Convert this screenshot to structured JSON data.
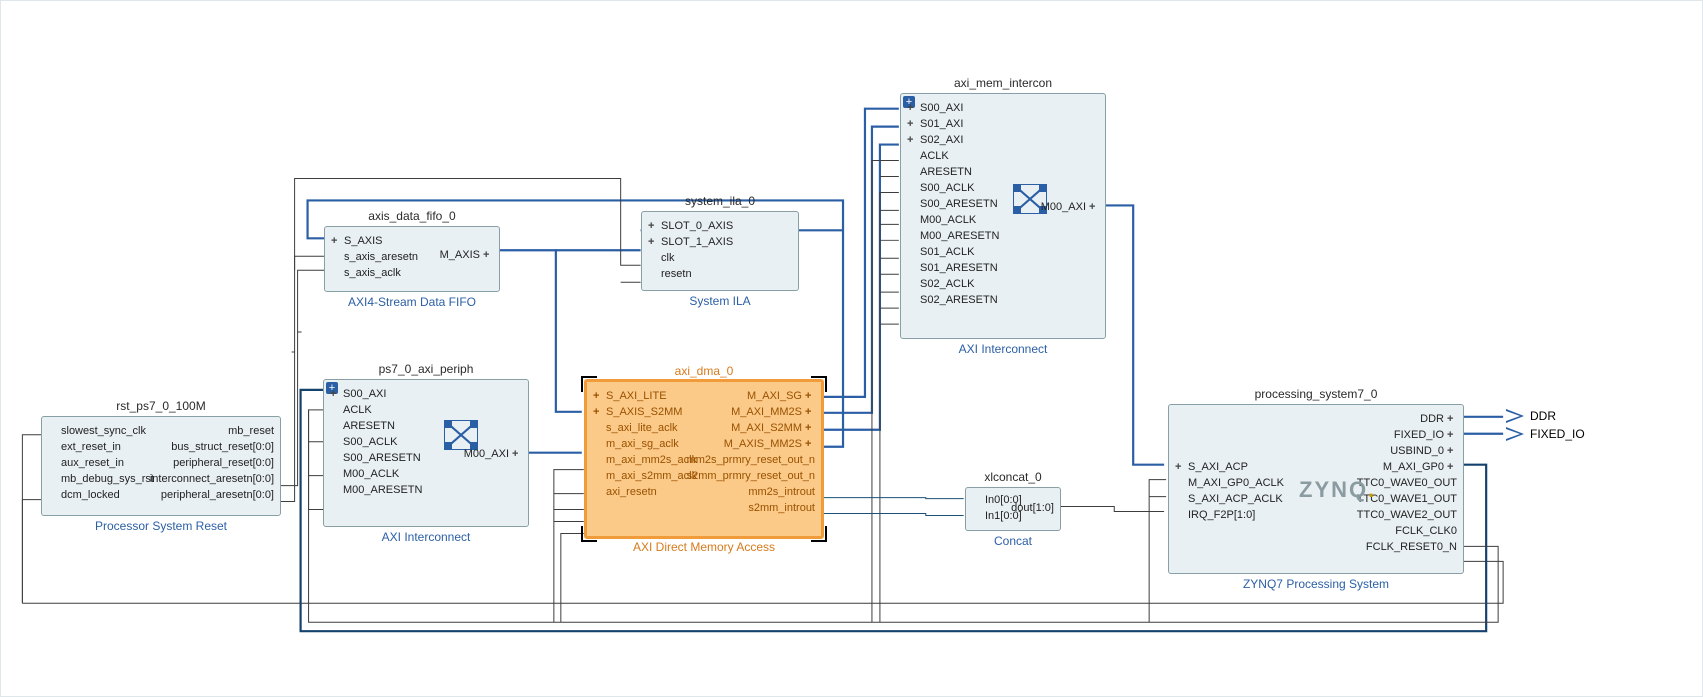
{
  "blocks": {
    "rst": {
      "title": "rst_ps7_0_100M",
      "subtitle": "Processor System Reset",
      "left": [
        "slowest_sync_clk",
        "ext_reset_in",
        "aux_reset_in",
        "mb_debug_sys_rst",
        "dcm_locked"
      ],
      "right": [
        "mb_reset",
        "bus_struct_reset[0:0]",
        "peripheral_reset[0:0]",
        "interconnect_aresetn[0:0]",
        "peripheral_aresetn[0:0]"
      ]
    },
    "fifo": {
      "title": "axis_data_fifo_0",
      "subtitle": "AXI4-Stream Data FIFO",
      "left_bus": [
        "S_AXIS"
      ],
      "left": [
        "s_axis_aresetn",
        "s_axis_aclk"
      ],
      "right_bus": [
        "M_AXIS"
      ]
    },
    "ila": {
      "title": "system_ila_0",
      "subtitle": "System ILA",
      "left_bus": [
        "SLOT_0_AXIS",
        "SLOT_1_AXIS"
      ],
      "left": [
        "clk",
        "resetn"
      ]
    },
    "periph": {
      "title": "ps7_0_axi_periph",
      "subtitle": "AXI Interconnect",
      "left_bus": [
        "S00_AXI"
      ],
      "left": [
        "ACLK",
        "ARESETN",
        "S00_ACLK",
        "S00_ARESETN",
        "M00_ACLK",
        "M00_ARESETN"
      ],
      "right_bus": [
        "M00_AXI"
      ]
    },
    "dma": {
      "title": "axi_dma_0",
      "subtitle": "AXI Direct Memory Access",
      "left_bus": [
        "S_AXI_LITE",
        "S_AXIS_S2MM"
      ],
      "left": [
        "s_axi_lite_aclk",
        "m_axi_sg_aclk",
        "m_axi_mm2s_aclk",
        "m_axi_s2mm_aclk",
        "axi_resetn"
      ],
      "right_bus": [
        "M_AXI_SG",
        "M_AXI_MM2S",
        "M_AXI_S2MM",
        "M_AXIS_MM2S"
      ],
      "right": [
        "mm2s_prmry_reset_out_n",
        "s2mm_prmry_reset_out_n",
        "mm2s_introut",
        "s2mm_introut"
      ]
    },
    "intercon": {
      "title": "axi_mem_intercon",
      "subtitle": "AXI Interconnect",
      "left_bus": [
        "S00_AXI",
        "S01_AXI",
        "S02_AXI"
      ],
      "left": [
        "ACLK",
        "ARESETN",
        "S00_ACLK",
        "S00_ARESETN",
        "M00_ACLK",
        "M00_ARESETN",
        "S01_ACLK",
        "S01_ARESETN",
        "S02_ACLK",
        "S02_ARESETN"
      ],
      "right_bus": [
        "M00_AXI"
      ]
    },
    "concat": {
      "title": "xlconcat_0",
      "subtitle": "Concat",
      "left": [
        "In0[0:0]",
        "In1[0:0]"
      ],
      "right": [
        "dout[1:0]"
      ]
    },
    "ps": {
      "title": "processing_system7_0",
      "subtitle": "ZYNQ7 Processing System",
      "left_bus": [
        "S_AXI_ACP"
      ],
      "left": [
        "M_AXI_GP0_ACLK",
        "S_AXI_ACP_ACLK",
        "IRQ_F2P[1:0]"
      ],
      "right_top": [
        "DDR",
        "FIXED_IO",
        "USBIND_0",
        "M_AXI_GP0"
      ],
      "right": [
        "TTC0_WAVE0_OUT",
        "TTC0_WAVE1_OUT",
        "TTC0_WAVE2_OUT",
        "FCLK_CLK0",
        "FCLK_RESET0_N"
      ],
      "logo": "ZYNQ"
    }
  },
  "external": {
    "ddr": "DDR",
    "fixed_io": "FIXED_IO"
  }
}
